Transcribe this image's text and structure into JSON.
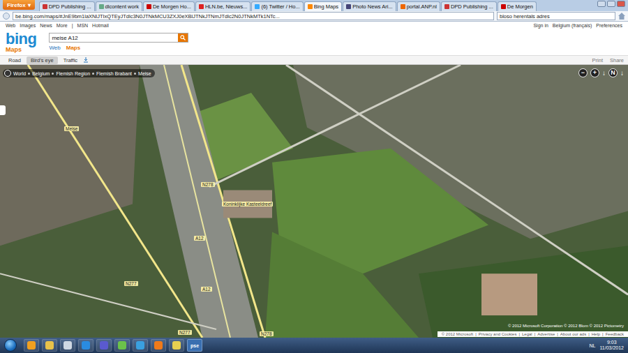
{
  "browser": {
    "menu_button": "Firefox",
    "tabs": [
      {
        "label": "DPD Publishing ...",
        "selected": false
      },
      {
        "label": "dlcontent work",
        "selected": false
      },
      {
        "label": "De Morgen Ho...",
        "selected": false
      },
      {
        "label": "HLN.be, Nieuws...",
        "selected": false
      },
      {
        "label": "(6) Twitter / Ho...",
        "selected": false
      },
      {
        "label": "Bing Maps",
        "selected": true
      },
      {
        "label": "Photo News Ari...",
        "selected": false
      },
      {
        "label": "portal.ANP.nl",
        "selected": false
      },
      {
        "label": "DPD Publishing ...",
        "selected": false
      },
      {
        "label": "De Morgen",
        "selected": false
      }
    ],
    "address": "be.bing.com/maps/#JnE9bm1laXNlJTIxQTEyJTdlc3N0JTNkMCU3ZXJ0eXBlJTNkJTNmJTdlc2N0JTNkMTk1NTc...",
    "search": "bloso herentals adres"
  },
  "bing": {
    "top_links": [
      "Web",
      "Images",
      "News",
      "More"
    ],
    "msn_links": [
      "MSN",
      "Hotmail"
    ],
    "account_links": [
      "Sign in",
      "Belgium (français)",
      "Preferences"
    ],
    "logo": "bing",
    "logo_sub": "Maps",
    "query": "meise A12",
    "verticals": [
      {
        "label": "Web",
        "selected": false
      },
      {
        "label": "Maps",
        "selected": true
      }
    ],
    "map_modes": [
      {
        "label": "Road",
        "selected": false
      },
      {
        "label": "Bird's eye",
        "selected": true
      },
      {
        "label": "Traffic",
        "selected": false
      }
    ],
    "map_actions": [
      "Print",
      "Share"
    ]
  },
  "map": {
    "breadcrumb": [
      "World",
      "Belgium",
      "Flemish Region",
      "Flemish Brabant",
      "Meise"
    ],
    "labels": [
      "Meise",
      "A12",
      "A12",
      "N277",
      "N278",
      "N278",
      "N277",
      "Koninklijke Kasteeldreef"
    ],
    "zoom_out": "−",
    "zoom_in": "+",
    "compass": "N",
    "attribution": "© 2012 Microsoft Corporation  © 2012 Blom  © 2012 Pictometry"
  },
  "footer": [
    "© 2012 Microsoft",
    "Privacy and Cookies",
    "Legal",
    "Advertise",
    "About our ads",
    "Help",
    "Feedback"
  ],
  "taskbar": {
    "pse_label": "pse",
    "language": "NL",
    "time": "9:03",
    "date": "11/03/2012"
  }
}
